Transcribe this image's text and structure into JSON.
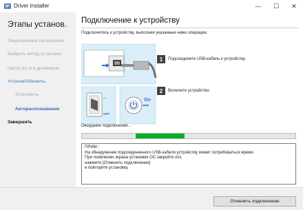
{
  "window": {
    "title": "Driver Installer",
    "minimize_symbol": "—",
    "maximize_symbol": "☐",
    "close_symbol": "✕"
  },
  "sidebar": {
    "title": "Этапы установ.",
    "items": [
      {
        "label": "Лицензионное соглашение",
        "state": "done"
      },
      {
        "label": "Выбрать метод установки",
        "state": "done"
      },
      {
        "label": "Настр.уст-в и драйверов",
        "state": "done"
      },
      {
        "label": "Установ/Обновить",
        "state": "current"
      },
      {
        "label": "Установить",
        "state": "sub-pending"
      },
      {
        "label": "Автораспознавание",
        "state": "sub-active"
      },
      {
        "label": "Завершить",
        "state": "pending"
      }
    ]
  },
  "main": {
    "title": "Подключение к устройству",
    "instruction": "Подключитесь к устройству, выполняя указанные ниже операции.",
    "steps": [
      {
        "number": "1",
        "text": "Подсоедините USB-кабель к устройству."
      },
      {
        "number": "2",
        "text": "Включите устройство."
      }
    ],
    "illustration_labels": {
      "on": "On",
      "off": "OFF"
    },
    "wait_text": "Ожидание подключения...",
    "progress": {
      "start": 0.25,
      "fill": 0.23,
      "color": "#06b025"
    },
    "note_lines": [
      "ПРИМ.:",
      "На обнаружение подсоединенного USB-кабеля устройству может потребоваться время.",
      "При появлении экрана установки ОС закройте его,",
      "нажмите [Отменить подключение]",
      "и повторите установку."
    ]
  },
  "footer": {
    "cancel_label": "Отменить подключение"
  },
  "colors": {
    "accent": "#2f6fb8",
    "progress": "#06b025",
    "sidebar_bg": "#f0f0f0"
  }
}
